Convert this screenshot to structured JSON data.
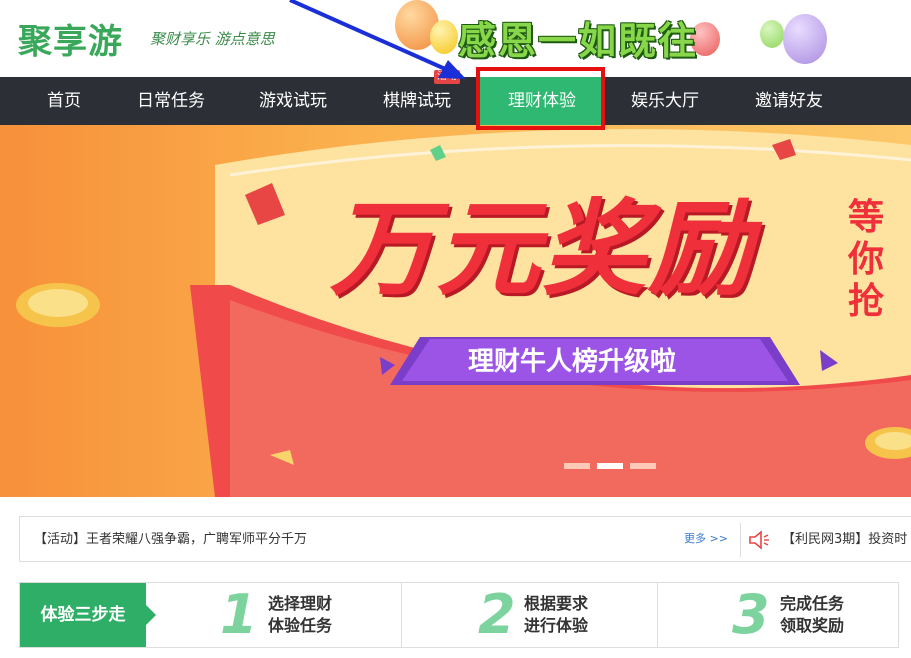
{
  "header": {
    "logo": "聚享游",
    "slogan": "聚财享乐 游点意思",
    "promo": "感恩一如既往"
  },
  "nav": {
    "items": [
      {
        "label": "首页"
      },
      {
        "label": "日常任务"
      },
      {
        "label": "游戏试玩"
      },
      {
        "label": "棋牌试玩"
      },
      {
        "label": "理财体验",
        "active": true
      },
      {
        "label": "娱乐大厅"
      },
      {
        "label": "邀请好友"
      }
    ],
    "badge": "活动"
  },
  "banner": {
    "headline": "万元奖励",
    "side_text": "等你抢",
    "ribbon": "理财牛人榜升级啦",
    "active_slide": 2,
    "slide_count": 3
  },
  "notice": {
    "text": "【活动】王者荣耀八强争霸，广聘军师平分千万",
    "more": "更多 >>",
    "text2": "【利民网3期】投资时"
  },
  "steps": {
    "title": "体验三步走",
    "items": [
      {
        "num": "1",
        "line1": "选择理财",
        "line2": "体验任务"
      },
      {
        "num": "2",
        "line1": "根据要求",
        "line2": "进行体验"
      },
      {
        "num": "3",
        "line1": "完成任务",
        "line2": "领取奖励"
      }
    ]
  },
  "colors": {
    "brand_green": "#2eb872",
    "nav_bg": "#2d2f36",
    "annotation_red": "#e61010",
    "annotation_blue": "#1a2fd8"
  }
}
